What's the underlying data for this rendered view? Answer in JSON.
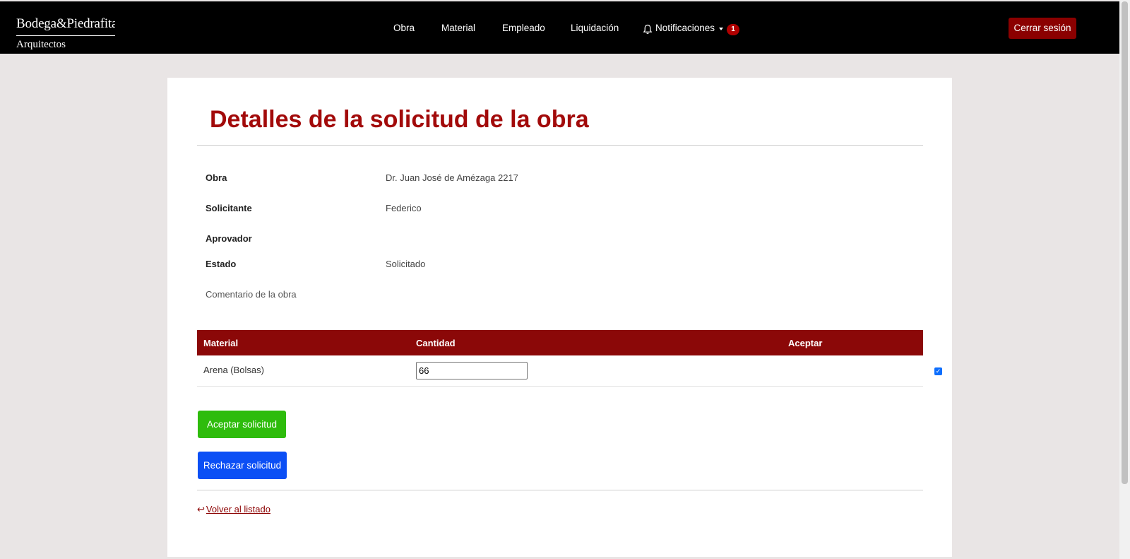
{
  "brand": {
    "name_line1": "Bodega&Piedrafita",
    "name_line2": "Arquitectos"
  },
  "nav": {
    "items": [
      {
        "label": "Obra"
      },
      {
        "label": "Material"
      },
      {
        "label": "Empleado"
      },
      {
        "label": "Liquidación"
      },
      {
        "label": "Notificaciones"
      }
    ],
    "notification_count": "1",
    "logout_label": "Cerrar sesión",
    "icons": {
      "notifications": "bell-icon",
      "dropdown": "caret-down-icon"
    }
  },
  "page": {
    "title": "Detalles de la solicitud de la obra"
  },
  "details": {
    "obra": {
      "label": "Obra",
      "value": "Dr. Juan José de Amézaga 2217"
    },
    "solicitante": {
      "label": "Solicitante",
      "value": "Federico"
    },
    "aprovador": {
      "label": "Aprovador",
      "value": ""
    },
    "estado": {
      "label": "Estado",
      "value": "Solicitado"
    },
    "comentario": {
      "label": "Comentario de la obra"
    }
  },
  "table": {
    "headers": [
      "Material",
      "Cantidad",
      "Aceptar"
    ],
    "rows": [
      {
        "material": "Arena (Bolsas)",
        "cantidad": "66",
        "aceptar": true
      }
    ]
  },
  "actions": {
    "accept_label": "Aceptar solicitud",
    "reject_label": "Rechazar solicitud",
    "back_label": "Volver al listado"
  },
  "colors": {
    "accent": "#a20a0a",
    "table_header": "#8b0808",
    "accept_button": "#2ebc0c",
    "reject_button": "#0b4ff5",
    "navbar": "#000000"
  }
}
